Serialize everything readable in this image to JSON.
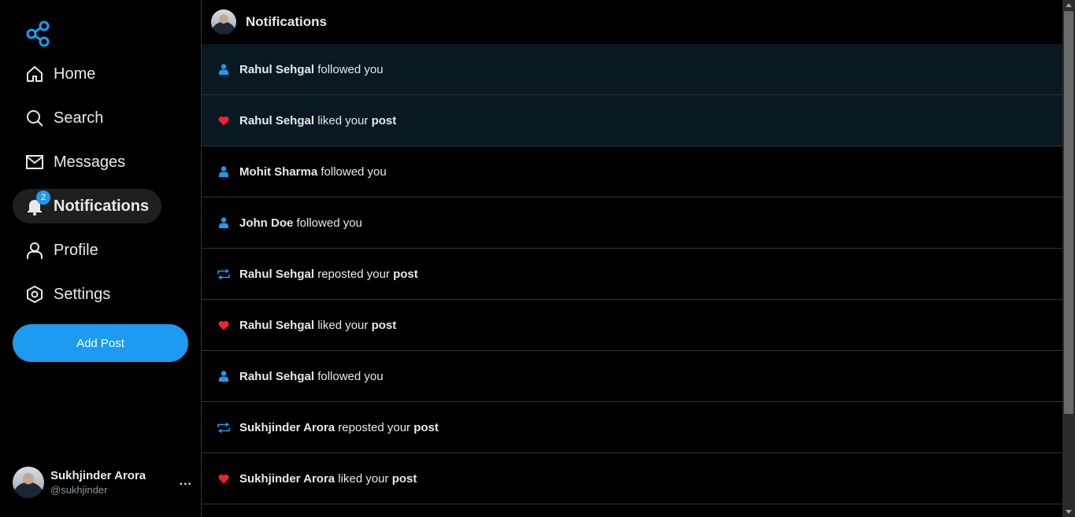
{
  "sidebar": {
    "items": [
      {
        "label": "Home",
        "icon": "home-icon"
      },
      {
        "label": "Search",
        "icon": "search-icon"
      },
      {
        "label": "Messages",
        "icon": "mail-icon"
      },
      {
        "label": "Notifications",
        "icon": "bell-icon",
        "badge": "2",
        "active": true
      },
      {
        "label": "Profile",
        "icon": "user-icon"
      },
      {
        "label": "Settings",
        "icon": "settings-icon"
      }
    ],
    "add_post_label": "Add Post",
    "user": {
      "name": "Sukhjinder Arora",
      "handle": "@sukhjinder",
      "more": "..."
    }
  },
  "header": {
    "title": "Notifications"
  },
  "notifications": [
    {
      "type": "follow",
      "actor": "Rahul Sehgal",
      "text": " followed you",
      "target": "",
      "unread": true
    },
    {
      "type": "like",
      "actor": "Rahul Sehgal",
      "text": " liked your ",
      "target": "post",
      "unread": true
    },
    {
      "type": "follow",
      "actor": "Mohit Sharma",
      "text": " followed you",
      "target": "",
      "unread": false
    },
    {
      "type": "follow",
      "actor": "John Doe",
      "text": " followed you",
      "target": "",
      "unread": false
    },
    {
      "type": "repost",
      "actor": "Rahul Sehgal",
      "text": " reposted your ",
      "target": "post",
      "unread": false
    },
    {
      "type": "like",
      "actor": "Rahul Sehgal",
      "text": " liked your ",
      "target": "post",
      "unread": false
    },
    {
      "type": "follow",
      "actor": "Rahul Sehgal",
      "text": " followed you",
      "target": "",
      "unread": false
    },
    {
      "type": "repost",
      "actor": "Sukhjinder Arora",
      "text": " reposted your ",
      "target": "post",
      "unread": false
    },
    {
      "type": "like",
      "actor": "Sukhjinder Arora",
      "text": " liked your ",
      "target": "post",
      "unread": false
    }
  ],
  "colors": {
    "accent": "#1d9bf0",
    "like": "#f4212e",
    "background": "#000000",
    "border": "#2f3336"
  }
}
